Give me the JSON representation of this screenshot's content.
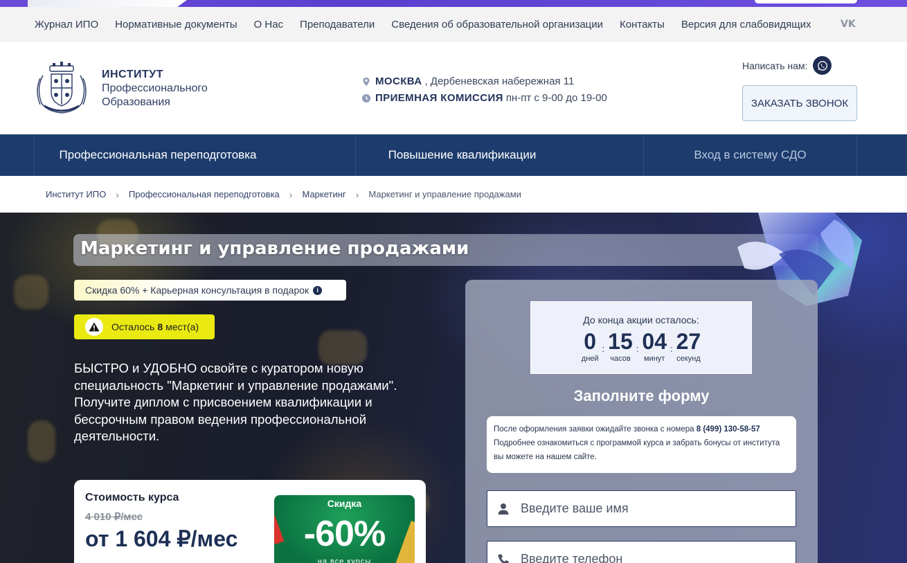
{
  "top_nav": {
    "items": [
      "Журнал ИПО",
      "Нормативные документы",
      "О Нас",
      "Преподаватели",
      "Сведения об образовательной организации",
      "Контакты",
      "Версия для слабовидящих"
    ],
    "vk_label": "VK"
  },
  "header": {
    "brand_line1": "ИНСТИТУТ",
    "brand_line2": "Профессионального",
    "brand_line3": "Образования",
    "city": "МОСКВА",
    "address": ", Дербеневская набережная 11",
    "office_label": "ПРИЕМНАЯ КОМИССИЯ",
    "office_hours": " пн-пт с 9-00 до 19-00",
    "write_us": "Написать нам:",
    "call_button": "ЗАКАЗАТЬ ЗВОНОК"
  },
  "main_nav": {
    "items": [
      "Профессиональная переподготовка",
      "Повышение квалификации",
      "Вход в систему СДО"
    ]
  },
  "breadcrumbs": [
    "Институт ИПО",
    "Профессиональная переподготовка",
    "Маркетинг",
    "Маркетинг и управление продажами"
  ],
  "hero": {
    "title": "Маркетинг и управление продажами",
    "discount_badge": "Скидка 60% + Карьерная консультация в подарок",
    "info_icon_glyph": "i",
    "places_prefix": "Осталось",
    "places_count": "8",
    "places_suffix": "мест(а)",
    "lead": "БЫСТРО и УДОБНО освойте с куратором новую специальность \"Маркетинг и управление продажами\". Получите диплом с присвоением квалификации и бессрочным правом ведения профессиональной деятельности."
  },
  "price": {
    "label": "Стоимость курса",
    "old_price": "4 010 ₽/мес",
    "new_price": "от 1 604 ₽/мес",
    "promo_title": "Скидка",
    "promo_value": "-60%",
    "promo_sub": "на все курсы"
  },
  "form": {
    "timer_caption": "До конца акции осталось:",
    "timer": [
      {
        "value": "0",
        "unit": "дней"
      },
      {
        "value": "15",
        "unit": "часов"
      },
      {
        "value": "04",
        "unit": "минут"
      },
      {
        "value": "27",
        "unit": "секунд"
      }
    ],
    "title": "Заполните форму",
    "note_text": "После оформления заявки ожидайте звонка с номера ",
    "note_phone": "8 (499) 130-58-57",
    "note_text2": "Подробнее ознакомиться с программой курса и забрать бонусы от института вы можете на нашем сайте.",
    "name_placeholder": "Введите ваше имя",
    "phone_placeholder": "Введите телефон"
  },
  "colors": {
    "nav_blue": "#1d3c6d",
    "brand_dark": "#24345b",
    "places_yellow": "#eaea12",
    "promo_green": "#0b7240"
  }
}
